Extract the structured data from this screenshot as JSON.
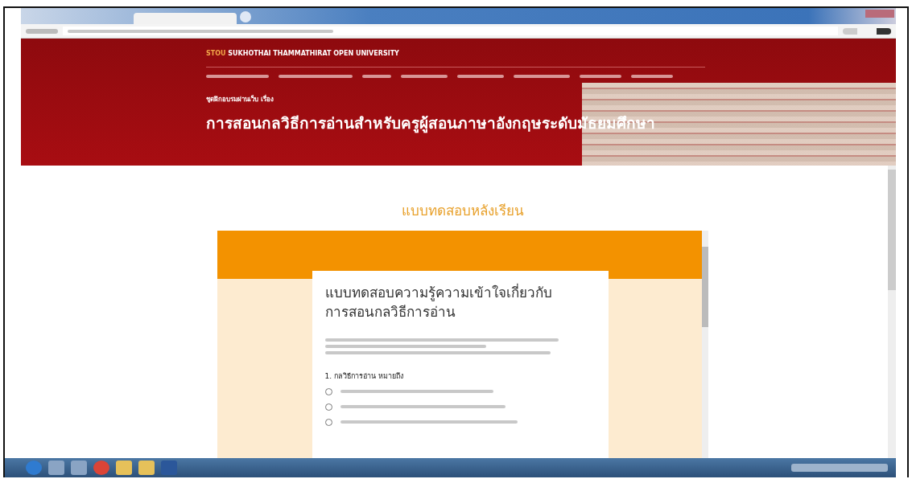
{
  "site": {
    "brand_short": "STOU",
    "brand": "SUKHOTHAI THAMMATHIRAT OPEN UNIVERSITY",
    "subtitle": "ชุดฝึกอบรมผ่านเว็บ เรื่อง",
    "title": "การสอนกลวิธีการอ่านสำหรับครูผู้สอนภาษาอังกฤษระดับมัธยมศึกษา"
  },
  "section_heading": "แบบทดสอบหลังเรียน",
  "form": {
    "title": "แบบทดสอบความรู้ความเข้าใจเกี่ยวกับการสอนกลวิธีการอ่าน",
    "question": "1. กลวิธีการอ่าน หมายถึง",
    "options": [
      {
        "checked": false
      },
      {
        "checked": false
      },
      {
        "checked": false
      }
    ]
  }
}
